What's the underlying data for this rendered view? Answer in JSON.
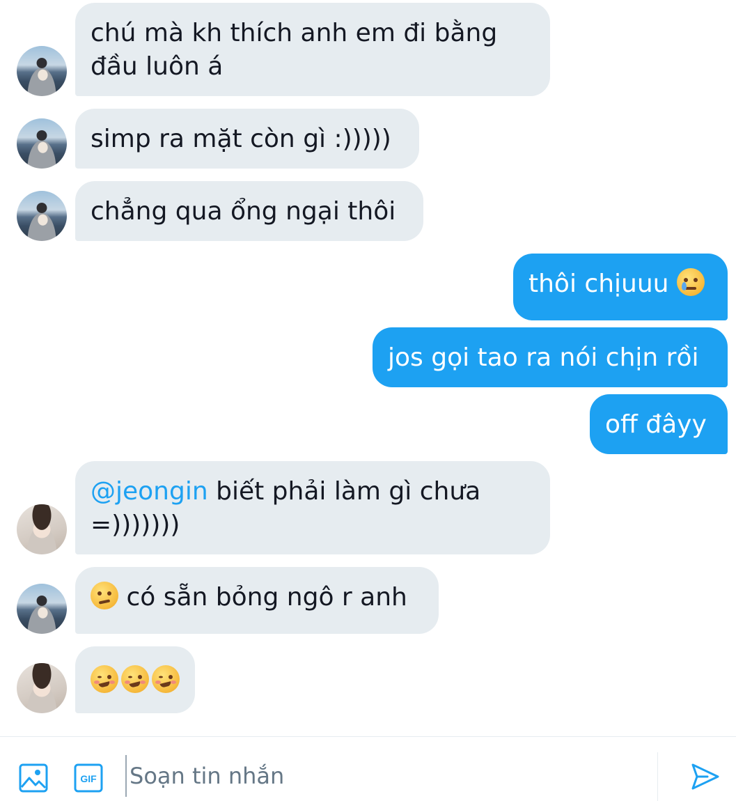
{
  "messages": [
    {
      "side": "in",
      "avatar": "a",
      "lines": [
        "chú mà kh thích anh em đi bằng",
        "đầu luôn á"
      ]
    },
    {
      "side": "in",
      "avatar": "a",
      "text": "simp ra mặt còn gì :)))))"
    },
    {
      "side": "in",
      "avatar": "a",
      "text": "chẳng qua ổng ngại thôi"
    },
    {
      "side": "out",
      "text": "thôi chịuuu",
      "emoji": "face-holding-back-tears-emoji"
    },
    {
      "side": "out",
      "text": "jos gọi tao ra nói chịn rồi"
    },
    {
      "side": "out",
      "text": "off đâyy"
    },
    {
      "side": "in",
      "avatar": "b",
      "mention": "@jeongin",
      "lines": [
        " biết phải làm gì chưa",
        "=)))))))"
      ]
    },
    {
      "side": "in",
      "avatar": "a",
      "emoji": "smirking-face-emoji",
      "text": " có sẵn bỏng ngô r anh"
    },
    {
      "side": "in",
      "avatar": "b",
      "emojis": [
        "woozy-face-emoji",
        "woozy-face-emoji",
        "woozy-face-emoji"
      ]
    }
  ],
  "composer": {
    "placeholder": "Soạn tin nhắn",
    "image_icon": "image-icon",
    "gif_icon": "gif-icon",
    "gif_label": "GIF",
    "send_icon": "send-icon"
  },
  "colors": {
    "accent": "#1da1f2",
    "incoming_bubble": "#e6ecf0",
    "text": "#141823"
  }
}
